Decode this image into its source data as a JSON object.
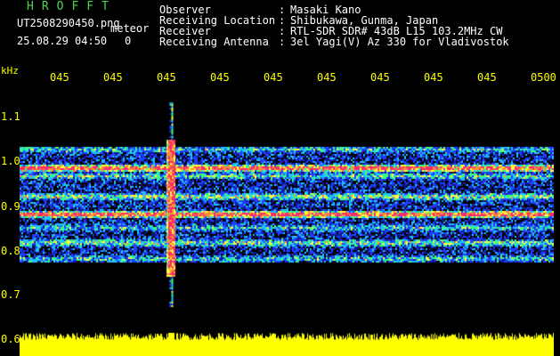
{
  "app": {
    "title": "HROFFT",
    "filename": "UT2508290450.png",
    "meteor_label": "meteor",
    "datetime": "25.08.29 04:50",
    "meteor_count": "0"
  },
  "station_info": [
    {
      "key": "Observer",
      "value": "Masaki Kano"
    },
    {
      "key": "Receiving Location",
      "value": "Shibukawa, Gunma, Japan"
    },
    {
      "key": "Receiver",
      "value": "RTL-SDR SDR# 43dB L15 103.2MHz CW"
    },
    {
      "key": "Receiving Antenna",
      "value": "3el Yagi(V) Az 330 for Vladivostok"
    }
  ],
  "axis": {
    "y_unit": "kHz",
    "y_ticks": [
      "1.1",
      "1.0",
      "0.9",
      "0.8",
      "0.7",
      "0.6"
    ],
    "x_ticks": [
      "045",
      "045",
      "045",
      "045",
      "045",
      "045",
      "045",
      "045",
      "045",
      "0500"
    ]
  },
  "colors": {
    "background": "#000000",
    "title": "#4cd34c",
    "info_text": "#ffffff",
    "axis_text": "#ffff00",
    "amplitude": "#ffff00",
    "meteor": "#ff2060",
    "carrier": "#ff3070"
  }
}
